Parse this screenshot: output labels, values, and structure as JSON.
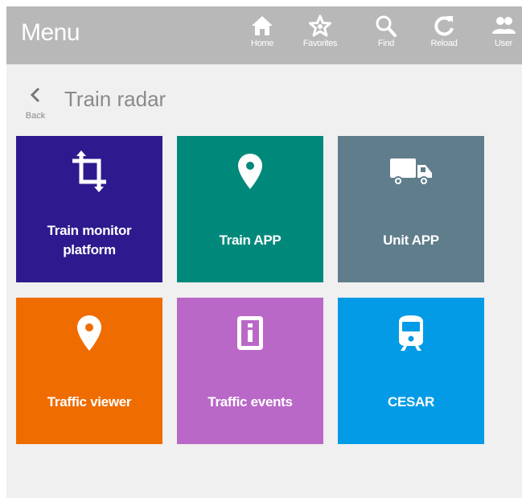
{
  "header": {
    "title": "Menu",
    "nav": [
      {
        "label": "Home",
        "icon": "home-icon"
      },
      {
        "label": "Favorites",
        "icon": "star-icon"
      },
      {
        "label": "Find",
        "icon": "search-icon"
      },
      {
        "label": "Reload",
        "icon": "reload-icon"
      },
      {
        "label": "User",
        "icon": "user-group-icon"
      }
    ]
  },
  "page": {
    "back_label": "Back",
    "back_icon": "chevron-left-icon",
    "title": "Train radar"
  },
  "tiles": [
    {
      "label": "Train monitor platform",
      "icon": "crop-icon",
      "color": "#2e1a8e"
    },
    {
      "label": "Train APP",
      "icon": "map-marker-icon",
      "color": "#00897b"
    },
    {
      "label": "Unit APP",
      "icon": "truck-icon",
      "color": "#607d8b"
    },
    {
      "label": "Traffic viewer",
      "icon": "map-marker-icon",
      "color": "#ef6c00"
    },
    {
      "label": "Traffic events",
      "icon": "info-box-icon",
      "color": "#ba68c8"
    },
    {
      "label": "CESAR",
      "icon": "train-icon",
      "color": "#039be5"
    }
  ]
}
